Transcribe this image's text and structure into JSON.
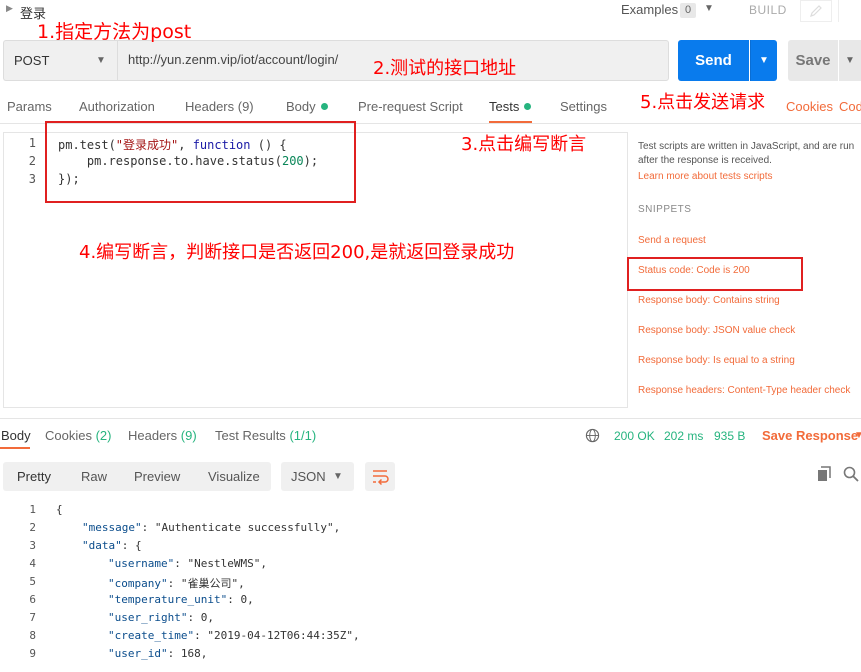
{
  "topbar": {
    "request_title": "登录",
    "examples_label": "Examples",
    "examples_count": "0",
    "build_label": "BUILD"
  },
  "request": {
    "method": "POST",
    "url": "http://yun.zenm.vip/iot/account/login/",
    "send_label": "Send",
    "save_label": "Save"
  },
  "request_tabs": [
    {
      "label": "Params"
    },
    {
      "label": "Authorization"
    },
    {
      "label": "Headers (9)"
    },
    {
      "label": "Body"
    },
    {
      "label": "Pre-request Script"
    },
    {
      "label": "Tests"
    },
    {
      "label": "Settings"
    }
  ],
  "right_links": {
    "cookies": "Cookies",
    "code": "Cod"
  },
  "editor": {
    "line_numbers": [
      "1",
      "2",
      "3"
    ],
    "line1": {
      "a": "pm.test(",
      "b": "\"登录成功\"",
      "c": ", ",
      "d": "function",
      "e": " () {"
    },
    "line2": {
      "a": "    pm.response.to.have.status(",
      "b": "200",
      "c": ");"
    },
    "line3": "});"
  },
  "side_panel": {
    "description": "Test scripts are written in JavaScript, and are run after the response is received.",
    "learn_link": "Learn more about tests scripts",
    "snippets_title": "SNIPPETS",
    "snippets": [
      "Send a request",
      "Status code: Code is 200",
      "Response body: Contains string",
      "Response body: JSON value check",
      "Response body: Is equal to a string",
      "Response headers: Content-Type header check"
    ]
  },
  "response_tabs": {
    "body": "Body",
    "cookies": "Cookies",
    "cookies_count": "(2)",
    "headers": "Headers",
    "headers_count": "(9)",
    "test_results": "Test Results",
    "test_results_count": "(1/1)"
  },
  "response_status": {
    "code": "200 OK",
    "time": "202 ms",
    "size": "935 B",
    "save_response": "Save Response"
  },
  "response_toolbar": {
    "views": [
      "Pretty",
      "Raw",
      "Preview",
      "Visualize"
    ],
    "format": "JSON"
  },
  "response_body": {
    "line_numbers": [
      "1",
      "2",
      "3",
      "4",
      "5",
      "6",
      "7",
      "8",
      "9"
    ],
    "lines": [
      {
        "key": "",
        "val": "{"
      },
      {
        "key": "\"message\"",
        "val": ": \"Authenticate successfully\","
      },
      {
        "key": "\"data\"",
        "val": ": {"
      },
      {
        "key": "\"username\"",
        "val": ": \"NestleWMS\","
      },
      {
        "key": "\"company\"",
        "val": ": \"雀巢公司\","
      },
      {
        "key": "\"temperature_unit\"",
        "val": ": 0,"
      },
      {
        "key": "\"user_right\"",
        "val": ": 0,"
      },
      {
        "key": "\"create_time\"",
        "val": ": \"2019-04-12T06:44:35Z\","
      },
      {
        "key": "\"user_id\"",
        "val": ": 168,"
      }
    ]
  },
  "annotations": {
    "a1": "1.指定方法为post",
    "a2": "2.测试的接口地址",
    "a3": "3.点击编写断言",
    "a4": "4.编写断言，判断接口是否返回200,是就返回登录成功",
    "a5": "5.点击发送请求"
  },
  "colors": {
    "accent": "#f26b3a",
    "send_blue": "#097bed",
    "success_green": "#26b47f",
    "annotation_red": "#ff0000"
  }
}
